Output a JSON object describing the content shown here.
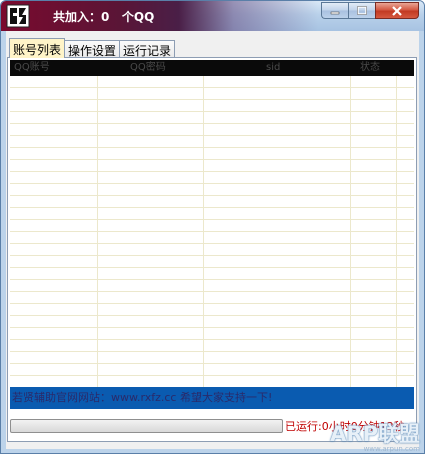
{
  "window": {
    "title": "共加入：0   个QQ",
    "controls": {
      "minimize_icon": "minimize-icon",
      "maximize_icon": "maximize-icon",
      "close_icon": "close-icon"
    }
  },
  "tabs": [
    {
      "label": "账号列表",
      "active": true
    },
    {
      "label": "操作设置",
      "active": false
    },
    {
      "label": "运行记录",
      "active": false
    }
  ],
  "table": {
    "columns": [
      "QQ账号",
      "QQ密码",
      "sid",
      "状态"
    ],
    "rows": []
  },
  "banner_text": "若贤辅助官网网站：www.rxfz.cc 希望大家支持一下!",
  "progress": {
    "fraction": 0.0
  },
  "runtime_text": "已运行:0小时0分钟12秒",
  "watermark": {
    "text": "ARP联盟",
    "url": "www.arpun.com"
  },
  "colors": {
    "tab_active": "#fff4c8",
    "banner": "#0a5bb0",
    "header": "#0a0a0a",
    "runtime": "#c00000"
  }
}
